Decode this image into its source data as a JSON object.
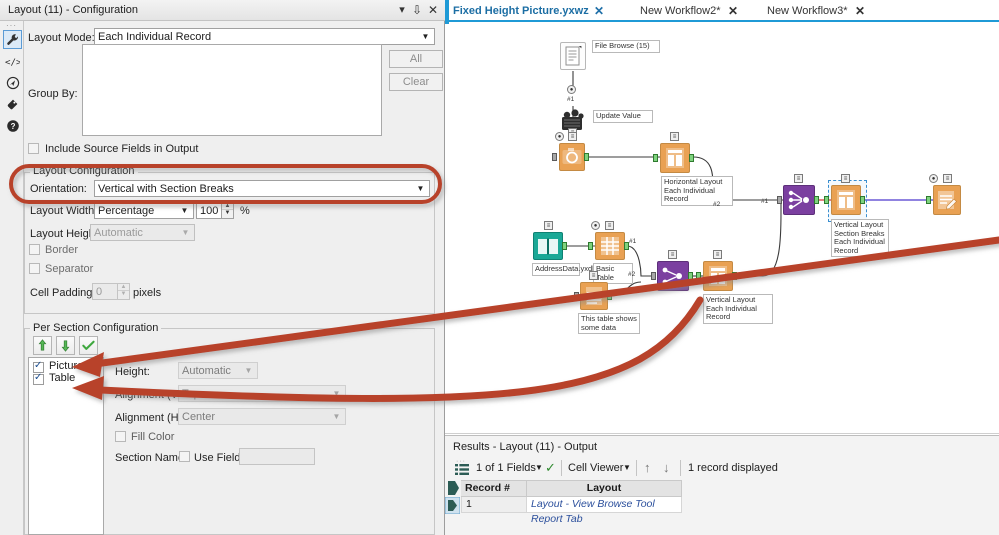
{
  "config_panel": {
    "title": "Layout (11) - Configuration",
    "titlebar_buttons": [
      {
        "name": "dropdown",
        "glyph": "▾"
      },
      {
        "name": "pin",
        "glyph": "⇩"
      },
      {
        "name": "close",
        "glyph": "✕"
      }
    ],
    "rail_icons": [
      {
        "name": "wrench-icon",
        "glyph": "🔧",
        "selected": true
      },
      {
        "name": "code-icon",
        "glyph": "</>",
        "selected": false
      },
      {
        "name": "globe-icon",
        "glyph": "❂",
        "selected": false
      },
      {
        "name": "tag-icon",
        "glyph": "🏷",
        "selected": false
      },
      {
        "name": "help-icon",
        "glyph": "?",
        "selected": false
      }
    ],
    "layout_mode_label": "Layout Mode:",
    "layout_mode_value": "Each Individual Record",
    "group_by_label": "Group By:",
    "all_button": "All",
    "clear_button": "Clear",
    "include_source_fields_label": "Include Source Fields in Output",
    "include_source_fields_checked": false,
    "layout_configuration": {
      "group_title": "Layout Configuration",
      "orientation_label": "Orientation:",
      "orientation_value": "Vertical with Section Breaks",
      "layout_width_label": "Layout Width:",
      "layout_width_value": "Percentage",
      "layout_width_number": "100",
      "layout_width_unit": "%",
      "layout_height_label": "Layout Height:",
      "layout_height_value": "Automatic",
      "border_label": "Border",
      "border_checked": false,
      "separator_label": "Separator",
      "separator_checked": false,
      "cell_padding_label": "Cell Padding:",
      "cell_padding_value": "0",
      "cell_padding_unit": "pixels"
    },
    "per_section_configuration": {
      "group_title": "Per Section Configuration",
      "toolbar": [
        {
          "name": "move-up-button",
          "glyph": "↑"
        },
        {
          "name": "move-down-button",
          "glyph": "↓"
        },
        {
          "name": "apply-check-button",
          "glyph": "✓"
        }
      ],
      "sections": [
        {
          "label": "Picture",
          "checked": true
        },
        {
          "label": "Table",
          "checked": true
        }
      ],
      "height_label": "Height:",
      "height_value": "Automatic",
      "alignment_v_label": "Alignment (V):",
      "alignment_v_value": "Top",
      "alignment_h_label": "Alignment (H):",
      "alignment_h_value": "Center",
      "fill_color_label": "Fill Color",
      "fill_color_checked": false,
      "section_name_label": "Section Name:",
      "use_field_label": "Use Field",
      "use_field_checked": false,
      "section_name_value": ""
    }
  },
  "tabs": [
    {
      "label": "Fixed Height Picture.yxwz",
      "active": true
    },
    {
      "label": "New Workflow2*",
      "active": false
    },
    {
      "label": "New Workflow3*",
      "active": false
    }
  ],
  "canvas": {
    "nodes": [
      {
        "name": "file-browse-node",
        "label": "File Browse (15)",
        "kind": "white",
        "icon": "document-icon"
      },
      {
        "name": "update-value-node",
        "label": "Update Value",
        "kind": "dark",
        "icon": "gears-icon"
      },
      {
        "name": "image-node",
        "label": "",
        "kind": "orange",
        "icon": "camera-icon"
      },
      {
        "name": "horizontal-layout-node",
        "label": "Horizontal Layout\nEach Individual\nRecord",
        "kind": "orange",
        "icon": "layout-icon"
      },
      {
        "name": "address-data-input-node",
        "label": "AddressData.yxdb",
        "kind": "teal",
        "icon": "book-icon"
      },
      {
        "name": "basic-table-node",
        "label": "Basic Table",
        "kind": "orange",
        "icon": "table-icon"
      },
      {
        "name": "text-table-node",
        "label": "This table shows\nsome data",
        "kind": "orange",
        "icon": "table-icon"
      },
      {
        "name": "join-multiple-node",
        "label": "",
        "kind": "purple",
        "icon": "join-icon"
      },
      {
        "name": "vertical-layout-node",
        "label": "Vertical Layout\nEach Individual\nRecord",
        "kind": "orange",
        "icon": "layout-icon"
      },
      {
        "name": "union-node",
        "label": "",
        "kind": "purple",
        "icon": "join-icon"
      },
      {
        "name": "vertical-layout-selected-node",
        "label": "Vertical Layout\nSection Breaks\nEach Individual\nRecord",
        "kind": "orange",
        "icon": "layout-icon",
        "selected": true
      },
      {
        "name": "render-node",
        "label": "",
        "kind": "orange",
        "icon": "render-icon"
      }
    ],
    "connection_tags": [
      "#1",
      "#2",
      "#2",
      "#1",
      "#2",
      "#1"
    ]
  },
  "results": {
    "title": "Results - Layout (11) - Output",
    "fields_selector": "1 of 1 Fields",
    "viewer_selector": "Cell Viewer",
    "record_status": "1 record displayed",
    "columns": [
      "Record #",
      "Layout"
    ],
    "rows": [
      {
        "record": "1",
        "layout": "Layout - View Browse Tool Report Tab"
      }
    ]
  },
  "annotations": {
    "highlight_color": "#b8422a",
    "shapes": [
      {
        "name": "orientation-highlight-ellipse"
      },
      {
        "name": "arrow-to-picture-section"
      },
      {
        "name": "arrow-to-table-section"
      }
    ]
  }
}
